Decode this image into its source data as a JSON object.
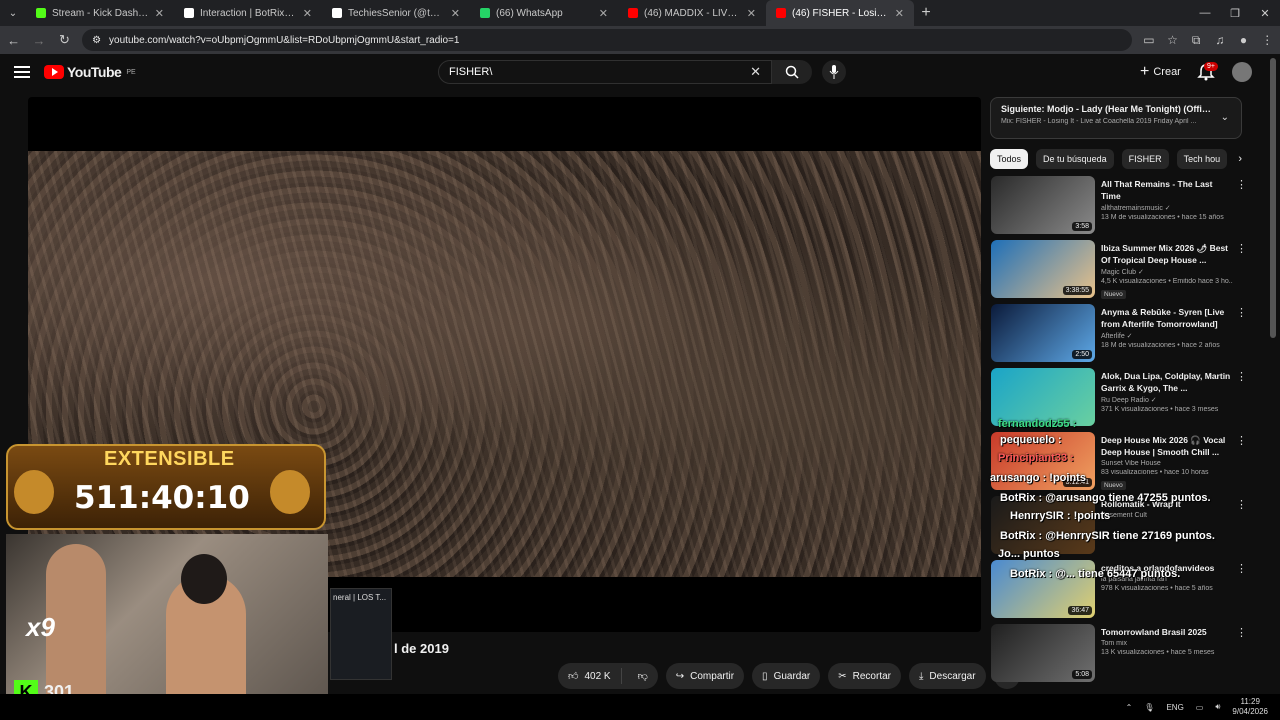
{
  "browser": {
    "tabs": [
      {
        "title": "Stream - Kick Dashboard",
        "color": "#53fc18"
      },
      {
        "title": "Interaction | BotRix — Cloud St",
        "color": "#ffffff"
      },
      {
        "title": "TechiesSenior (@techiessenior_",
        "color": "#ffffff"
      },
      {
        "title": "(66) WhatsApp",
        "color": "#25d366"
      },
      {
        "title": "(46) MADDIX - LIVE @ ULTRA M",
        "color": "#ff0000"
      },
      {
        "title": "(46) FISHER - Losing It - En",
        "color": "#ff0000",
        "active": true
      }
    ],
    "url": "youtube.com/watch?v=oUbpmjOgmmU&list=RDoUbpmjOgmmU&start_radio=1"
  },
  "youtube": {
    "logo_text": "YouTube",
    "logo_region": "PE",
    "search_value": "FISHER\\",
    "create_label": "Crear",
    "notif_badge": "9+"
  },
  "video": {
    "title_fragment": "l de 2019",
    "likes": "402 K",
    "share_label": "Compartir",
    "save_label": "Guardar",
    "clip_label": "Recortar",
    "download_label": "Descargar"
  },
  "next": {
    "title": "Siguiente: Modjo - Lady (Hear Me Tonight) (Official ...",
    "subtitle": "Mix: FISHER - Losing It - Live at Coachella 2019 Friday April ..."
  },
  "chips": [
    "Todos",
    "De tu búsqueda",
    "FISHER",
    "Tech hou"
  ],
  "recs": [
    {
      "title": "All That Remains - The Last Time",
      "channel": "allthatremainsmusic ✓",
      "meta": "13 M de visualizaciones • hace 15 años",
      "dur": "3:58",
      "c1": "#2a2a2a",
      "c2": "#8a8a8a"
    },
    {
      "title": "Ibiza Summer Mix 2026 🌶 Best Of Tropical Deep House ...",
      "channel": "Magic Club ✓",
      "meta": "4,5 K visualizaciones • Emitido hace 3 ho...",
      "dur": "3:38:55",
      "nuevo": "Nuevo",
      "c1": "#1e6fb8",
      "c2": "#e9c28a"
    },
    {
      "title": "Anyma & Rebūke - Syren [Live from Afterlife Tomorrowland]",
      "channel": "Afterlife ✓",
      "meta": "18 M de visualizaciones • hace 2 años",
      "dur": "2:50",
      "c1": "#0b1a3a",
      "c2": "#5ea9e8"
    },
    {
      "title": "Alok, Dua Lipa, Coldplay, Martin Garrix & Kygo, The ...",
      "channel": "Ru Deep Radio ✓",
      "meta": "371 K visualizaciones • hace 3 meses",
      "dur": "",
      "c1": "#1aa4c8",
      "c2": "#6ad0a0"
    },
    {
      "title": "Deep House Mix 2026 🎧 Vocal Deep House | Smooth Chill ...",
      "channel": "Sunset Vibe House",
      "meta": "83 visualizaciones • hace 10 horas",
      "dur": "3:12:41",
      "nuevo": "Nuevo",
      "c1": "#c83a2a",
      "c2": "#f0a060"
    },
    {
      "title": "Rollomatik - Wrap It",
      "channel": "Basement Cult",
      "meta": "",
      "dur": "",
      "c1": "#1a1a1a",
      "c2": "#5a3a1a"
    },
    {
      "title": "creditos a orlandofanvideos",
      "channel": "la paisana jacinta fan",
      "meta": "978 K visualizaciones • hace 5 años",
      "dur": "36:47",
      "c1": "#4a8ad0",
      "c2": "#e0d070"
    },
    {
      "title": "Tomorrowland Brasil 2025",
      "channel": "Tom mix",
      "meta": "13 K visualizaciones • hace 5 meses",
      "dur": "5:08",
      "c1": "#202020",
      "c2": "#707070"
    }
  ],
  "overlay": {
    "ext_label": "EXTENSIBLE",
    "timer": "511:40:10",
    "multiplier": "x9",
    "viewers": "301",
    "mini_title": "neral | LOS T..."
  },
  "chat": [
    {
      "text": "fernandodz55 :",
      "color": "#3ddc84"
    },
    {
      "text": "pequeuelo :",
      "color": "#ffffff"
    },
    {
      "text": "Principiant33 :",
      "color": "#ff5a5a"
    },
    {
      "text": "arusango : !points",
      "color": "#ffffff"
    },
    {
      "text": "BotRix : @arusango tiene 47255 puntos.",
      "color": "#ffffff"
    },
    {
      "text": "HenrrySIR : !points",
      "color": "#ffffff"
    },
    {
      "text": "BotRix : @HenrrySIR tiene 27169 puntos.",
      "color": "#ffffff"
    },
    {
      "text": "Jo... puntos",
      "color": "#ffffff"
    },
    {
      "text": "BotRix : @... tiene 65447 puntos.",
      "color": "#ffffff"
    }
  ],
  "taskbar": {
    "lang": "ENG",
    "time": "11:29",
    "date": "9/04/2026"
  }
}
